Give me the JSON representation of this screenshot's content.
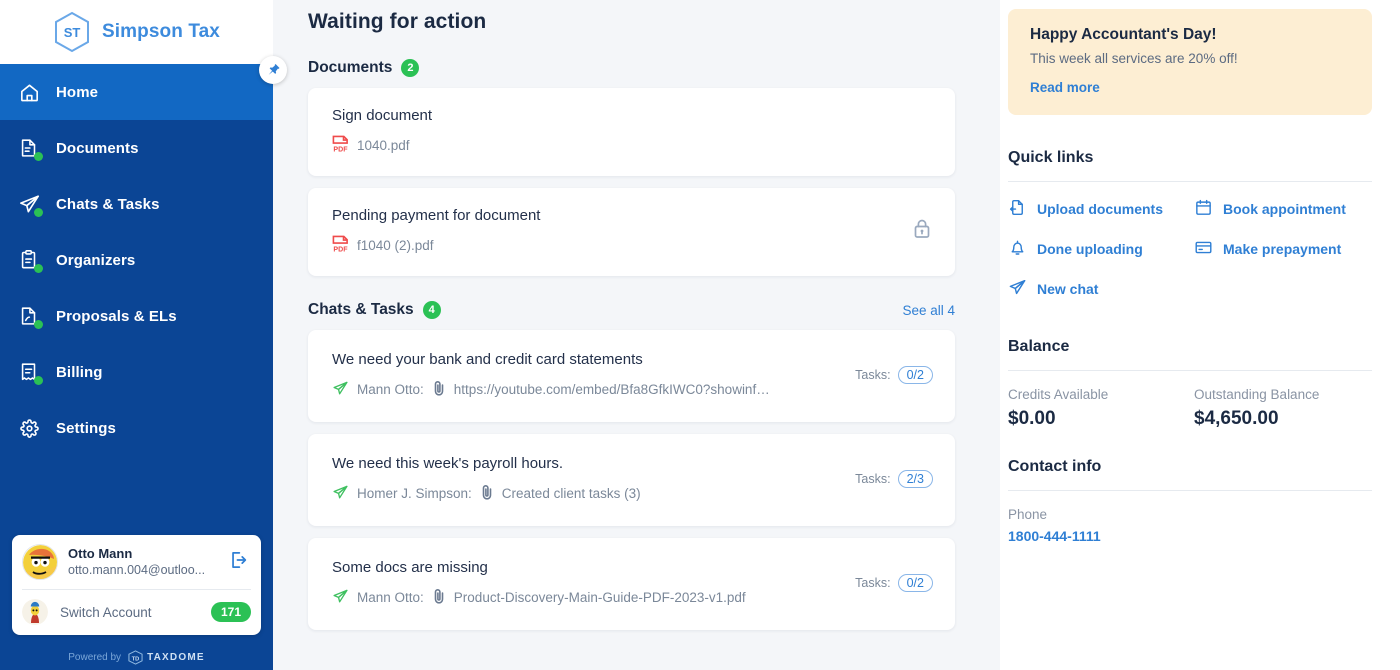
{
  "brand": {
    "logo_text": "ST",
    "name": "Simpson Tax",
    "pin_icon": "pin-icon"
  },
  "sidebar": {
    "items": [
      {
        "label": "Home",
        "icon": "home-icon",
        "active": true,
        "dot": false
      },
      {
        "label": "Documents",
        "icon": "documents-icon",
        "active": false,
        "dot": true
      },
      {
        "label": "Chats & Tasks",
        "icon": "paper-plane-icon",
        "active": false,
        "dot": true
      },
      {
        "label": "Organizers",
        "icon": "clipboard-icon",
        "active": false,
        "dot": true
      },
      {
        "label": "Proposals & ELs",
        "icon": "proposal-icon",
        "active": false,
        "dot": true
      },
      {
        "label": "Billing",
        "icon": "invoice-icon",
        "active": false,
        "dot": true
      },
      {
        "label": "Settings",
        "icon": "gear-icon",
        "active": false,
        "dot": false
      }
    ],
    "account": {
      "name": "Otto Mann",
      "email": "otto.mann.004@outloo...",
      "logout_icon": "logout-icon",
      "switch_label": "Switch Account",
      "switch_badge": "171"
    },
    "footer": {
      "powered_by": "Powered by",
      "brand_mark": "TD",
      "brand_word": "TAXDOME"
    }
  },
  "main": {
    "page_title": "Waiting for action",
    "documents_section": {
      "title": "Documents",
      "count": "2",
      "items": [
        {
          "title": "Sign document",
          "file": "1040.pdf",
          "file_icon": "pdf-icon",
          "lock": false
        },
        {
          "title": "Pending payment for document",
          "file": "f1040 (2).pdf",
          "file_icon": "pdf-icon",
          "lock": true,
          "lock_icon": "lock-icon"
        }
      ]
    },
    "chats_section": {
      "title": "Chats & Tasks",
      "count": "4",
      "see_all": "See all 4",
      "tasks_label": "Tasks:",
      "items": [
        {
          "title": "We need your bank and credit card statements",
          "author": "Mann Otto:",
          "message": "https://youtube.com/embed/Bfa8GfkIWC0?showinf…",
          "tasks": "0/2",
          "send_icon": "paper-plane-icon",
          "attach_icon": "paperclip-icon"
        },
        {
          "title": "We need this week's payroll hours.",
          "author": "Homer J. Simpson:",
          "message": "Created client tasks (3)",
          "tasks": "2/3",
          "send_icon": "paper-plane-icon",
          "attach_icon": "paperclip-icon"
        },
        {
          "title": "Some docs are missing",
          "author": "Mann Otto:",
          "message": "Product-Discovery-Main-Guide-PDF-2023-v1.pdf",
          "tasks": "0/2",
          "send_icon": "paper-plane-icon",
          "attach_icon": "paperclip-icon"
        }
      ]
    }
  },
  "rail": {
    "promo": {
      "title": "Happy Accountant's Day!",
      "text": "This week all services are 20% off!",
      "link": "Read more"
    },
    "quick_links": {
      "title": "Quick links",
      "items": [
        {
          "label": "Upload documents",
          "icon": "upload-file-icon"
        },
        {
          "label": "Book appointment",
          "icon": "calendar-icon"
        },
        {
          "label": "Done uploading",
          "icon": "bell-icon"
        },
        {
          "label": "Make prepayment",
          "icon": "credit-card-icon"
        },
        {
          "label": "New chat",
          "icon": "paper-plane-icon"
        }
      ]
    },
    "balance": {
      "title": "Balance",
      "credits_label": "Credits Available",
      "credits_value": "$0.00",
      "outstanding_label": "Outstanding Balance",
      "outstanding_value": "$4,650.00"
    },
    "contact": {
      "title": "Contact info",
      "phone_label": "Phone",
      "phone_value": "1800-444-1111"
    }
  },
  "colors": {
    "sidebar_bg": "#0b4595",
    "sidebar_active": "#1268c3",
    "accent_blue": "#2f7fd4",
    "green": "#2bc155",
    "promo_bg": "#fdeed3",
    "page_bg": "#f4f6f9",
    "pdf_red": "#ef4b4b"
  }
}
